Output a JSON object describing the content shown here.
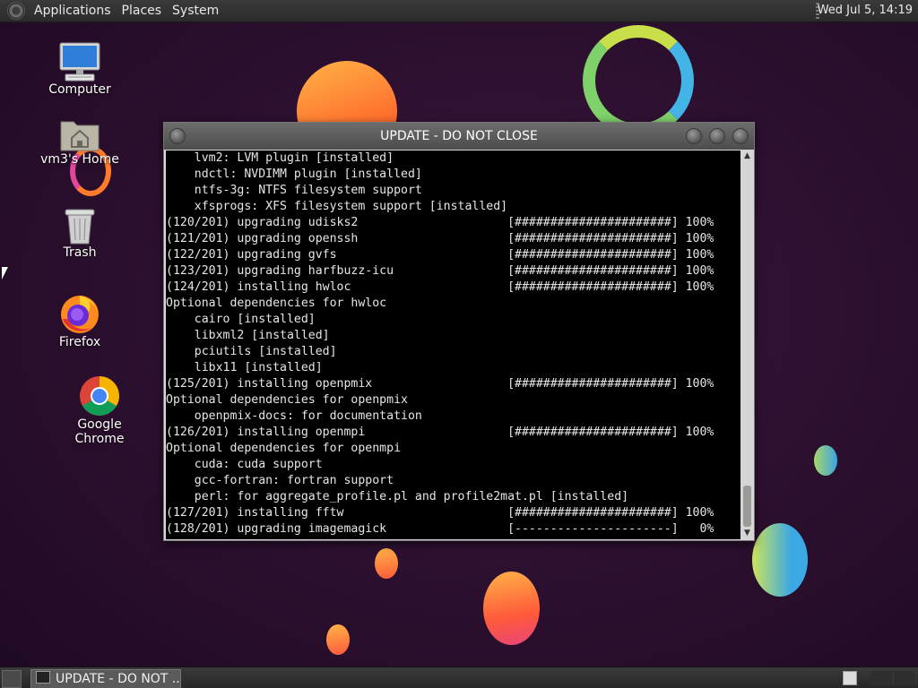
{
  "top_panel": {
    "menus": [
      "Applications",
      "Places",
      "System"
    ],
    "clock": "Wed Jul  5, 14:19"
  },
  "desktop_icons": [
    {
      "label": "Computer",
      "icon": "computer-icon"
    },
    {
      "label": "vm3's Home",
      "icon": "home-folder-icon"
    },
    {
      "label": "Trash",
      "icon": "trash-icon"
    },
    {
      "label": "Firefox",
      "icon": "firefox-icon"
    },
    {
      "label": "Google Chrome",
      "icon": "chrome-icon"
    }
  ],
  "window": {
    "title": "UPDATE - DO NOT CLOSE",
    "lines": [
      "    lvm2: LVM plugin [installed]",
      "    ndctl: NVDIMM plugin [installed]",
      "    ntfs-3g: NTFS filesystem support",
      "    xfsprogs: XFS filesystem support [installed]",
      "(120/201) upgrading udisks2                     [######################] 100%",
      "(121/201) upgrading openssh                     [######################] 100%",
      "(122/201) upgrading gvfs                        [######################] 100%",
      "(123/201) upgrading harfbuzz-icu                [######################] 100%",
      "(124/201) installing hwloc                      [######################] 100%",
      "Optional dependencies for hwloc",
      "    cairo [installed]",
      "    libxml2 [installed]",
      "    pciutils [installed]",
      "    libx11 [installed]",
      "(125/201) installing openpmix                   [######################] 100%",
      "Optional dependencies for openpmix",
      "    openpmix-docs: for documentation",
      "(126/201) installing openmpi                    [######################] 100%",
      "Optional dependencies for openmpi",
      "    cuda: cuda support",
      "    gcc-fortran: fortran support",
      "    perl: for aggregate_profile.pl and profile2mat.pl [installed]",
      "(127/201) installing fftw                       [######################] 100%",
      "(128/201) upgrading imagemagick                 [----------------------]   0%"
    ]
  },
  "taskbar": {
    "task_label": "UPDATE - DO NOT ..."
  },
  "colors": {
    "terminal_bg": "#000000",
    "terminal_fg": "#e6e6e6",
    "desktop_bg": "#2b0f2e"
  }
}
